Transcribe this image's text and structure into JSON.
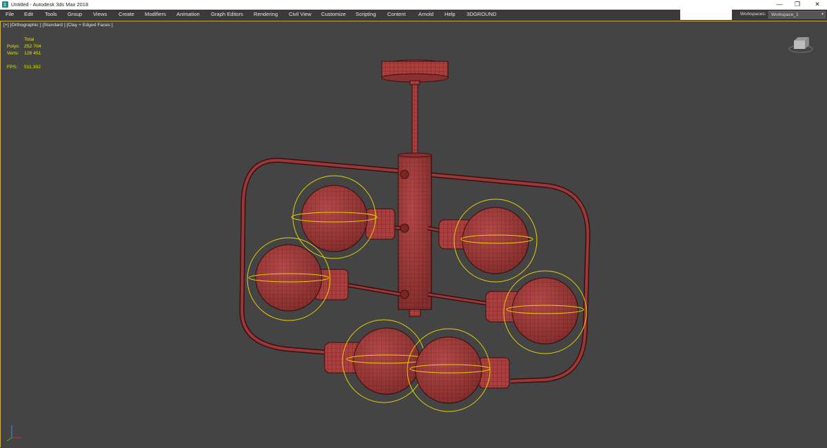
{
  "window": {
    "title": "Untitled - Autodesk 3ds Max 2018",
    "controls": [
      "—",
      "❐",
      "✕"
    ]
  },
  "menu": {
    "items": [
      "File",
      "Edit",
      "Tools",
      "Group",
      "Views",
      "Create",
      "Modifiers",
      "Animation",
      "Graph Editors",
      "Rendering",
      "Civil View",
      "Customize",
      "Scripting",
      "Content",
      "Arnold",
      "Help",
      "3DGROUND"
    ]
  },
  "workspace": {
    "label": "Workspaces:",
    "value": "Workspace_1"
  },
  "viewport": {
    "label": "[+] [Orthographic ] [Standard ] [Clay + Edged Faces ]",
    "stats": {
      "header": "Total",
      "polys_label": "Polys:",
      "polys_value": "252 704",
      "verts_label": "Verts:",
      "verts_value": "128 451",
      "fps_label": "FPS:",
      "fps_value": "511,352"
    }
  },
  "colors": {
    "model_fill": "#a8403f",
    "model_wire": "#5a1a1a",
    "selection": "#e6d200",
    "viewport_bg": "#444444",
    "viewport_border": "#d2b24a"
  }
}
